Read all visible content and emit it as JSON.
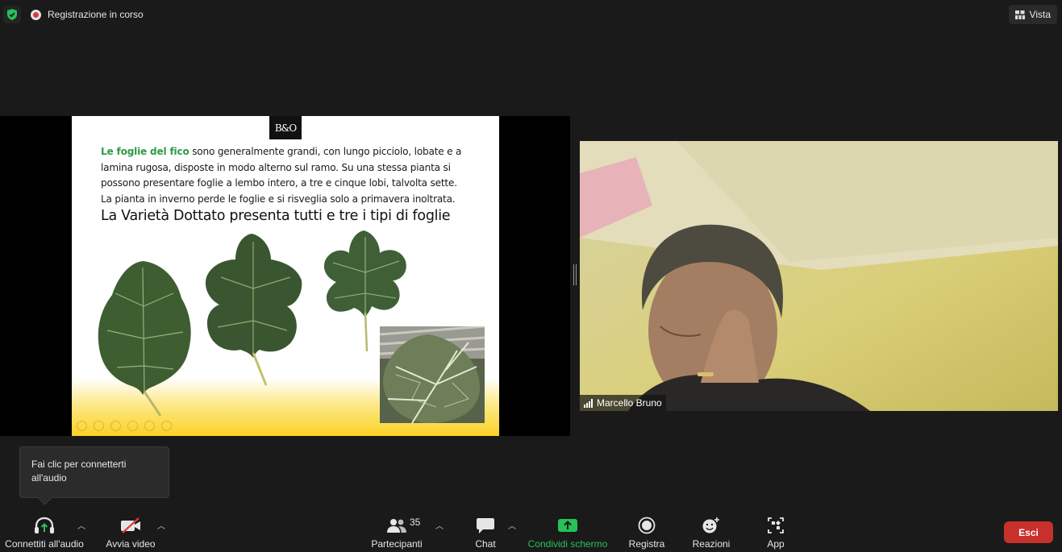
{
  "top": {
    "recording_label": "Registrazione in corso",
    "view_label": "Vista"
  },
  "slide": {
    "logo_text": "B&O",
    "para_highlight": "Le foglie del fico",
    "para_rest": " sono generalmente grandi, con lungo picciolo, lobate e a lamina rugosa, disposte in modo alterno sul ramo. Su una stessa pianta si possono presentare foglie a lembo intero, a tre e cinque lobi, talvolta sette. La pianta in inverno perde le foglie e si risveglia solo a primavera inoltrata.",
    "heading": "La Varietà Dottato presenta tutti e tre i tipi di foglie"
  },
  "participant": {
    "name": "Marcello Bruno"
  },
  "tooltip": {
    "text": "Fai clic per connetterti all'audio"
  },
  "toolbar": {
    "audio_label": "Connettiti all'audio",
    "video_label": "Avvia video",
    "participants_label": "Partecipanti",
    "participants_count": "35",
    "chat_label": "Chat",
    "share_label": "Condividi schermo",
    "record_label": "Registra",
    "reactions_label": "Reazioni",
    "apps_label": "App",
    "leave_label": "Esci"
  },
  "colors": {
    "accent_green": "#27c158",
    "leave_red": "#c8302c",
    "slide_highlight": "#2f9a48"
  },
  "icons": [
    "shield-check-icon",
    "recording-icon",
    "grid-view-icon",
    "headphones-icon",
    "video-off-icon",
    "participants-icon",
    "chat-icon",
    "share-screen-icon",
    "record-icon",
    "reactions-icon",
    "apps-icon",
    "signal-bars-icon"
  ]
}
